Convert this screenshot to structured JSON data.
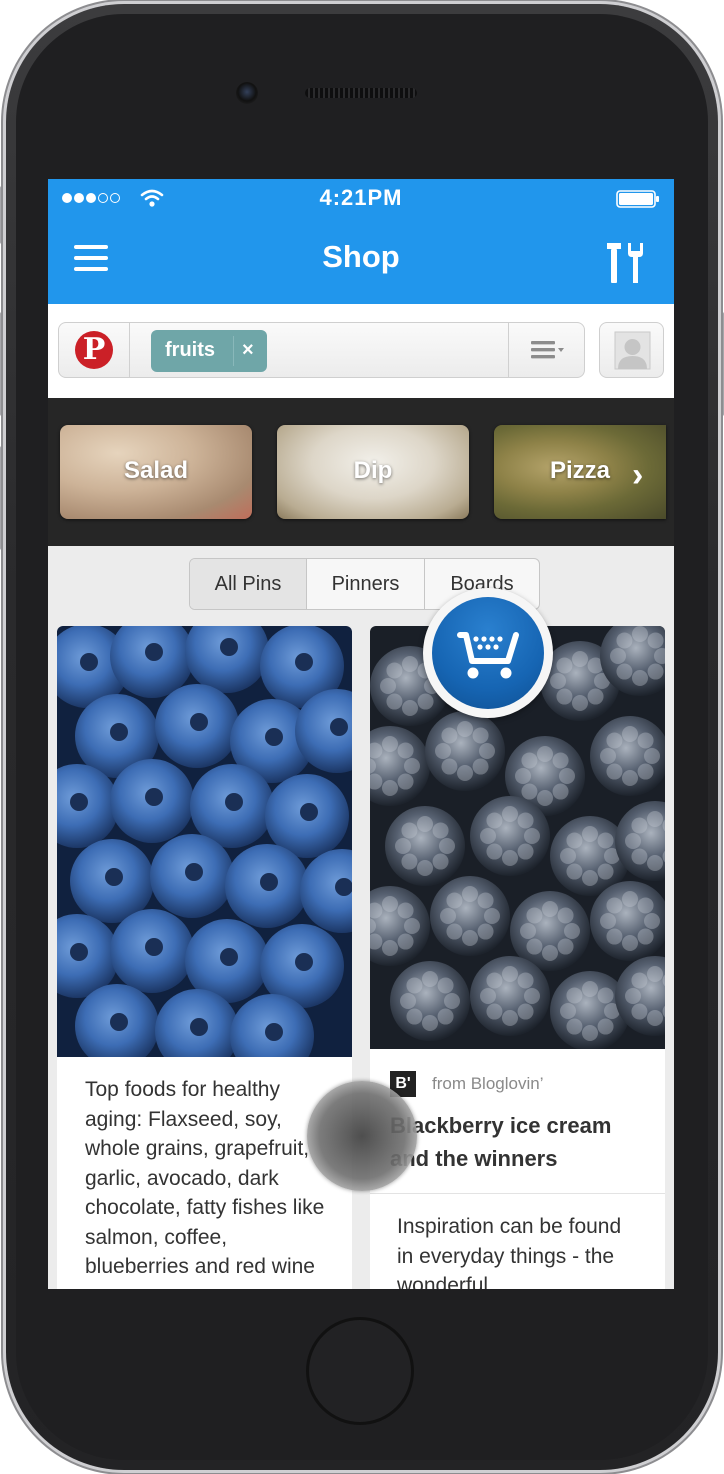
{
  "status_bar": {
    "time": "4:21PM"
  },
  "header": {
    "title": "Shop"
  },
  "search": {
    "chip_label": "fruits",
    "chip_remove": "×",
    "pinterest_logo": "P"
  },
  "categories": [
    {
      "label": "Salad"
    },
    {
      "label": "Dip"
    },
    {
      "label": "Pizza"
    }
  ],
  "categories_next": "›",
  "tabs": [
    {
      "label": "All Pins",
      "active": true
    },
    {
      "label": "Pinners"
    },
    {
      "label": "Boards"
    }
  ],
  "pins": {
    "left": {
      "description": "Top foods for healthy aging: Flaxseed, soy, whole grains, grapefruit, garlic, avocado, dark chocolate, fatty fishes like salmon, coffee, blueberries and red wine"
    },
    "right": {
      "source_icon": "B'",
      "source": "from Bloglovin’",
      "title": "Blackberry ice cream and the winners",
      "description": "Inspiration can be found in everyday things - the wonderful"
    }
  },
  "colors": {
    "header": "#2196ec",
    "chip": "#6fa6a8",
    "pinterest": "#cb2027",
    "cart": "#1665b3"
  },
  "icons": [
    "hamburger-menu-icon",
    "tools-icon",
    "list-icon",
    "user-icon",
    "cart-icon",
    "wifi-icon",
    "battery-icon"
  ]
}
